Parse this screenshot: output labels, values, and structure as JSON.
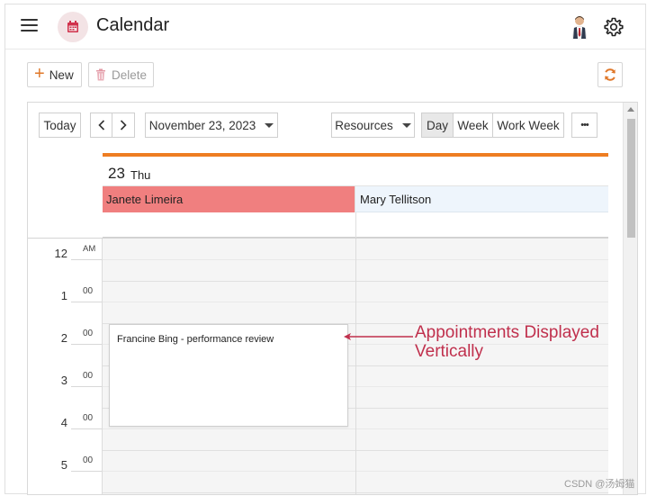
{
  "header": {
    "title": "Calendar",
    "menu_icon": "hamburger-menu-icon",
    "app_icon": "calendar-icon",
    "settings_icon": "gear-icon"
  },
  "toolbar": {
    "new_label": "New",
    "delete_label": "Delete",
    "refresh_icon": "refresh-icon"
  },
  "scheduler_toolbar": {
    "today_label": "Today",
    "date_label": "November 23, 2023",
    "resources_label": "Resources",
    "views": [
      "Day",
      "Week",
      "Work Week"
    ],
    "active_view": "Day",
    "more_label": "•••"
  },
  "day_header": {
    "date_number": "23",
    "day_name": "Thu"
  },
  "resources": [
    {
      "name": "Janete Limeira",
      "color": "#f07f7f"
    },
    {
      "name": "Mary Tellitson",
      "color": "#eef5fc"
    }
  ],
  "time_slots": [
    {
      "hour": "12",
      "suffix": "AM"
    },
    {
      "hour": "1",
      "suffix": "00"
    },
    {
      "hour": "2",
      "suffix": "00"
    },
    {
      "hour": "3",
      "suffix": "00"
    },
    {
      "hour": "4",
      "suffix": "00"
    },
    {
      "hour": "5",
      "suffix": "00"
    }
  ],
  "appointment": {
    "title": "Francine Bing - performance review"
  },
  "annotation": {
    "line1": "Appointments Displayed",
    "line2": "Vertically"
  },
  "watermark": "CSDN @汤姆猫",
  "colors": {
    "accent": "#ee7d22",
    "annotation": "#c0304d",
    "resource_1": "#f07f7f"
  }
}
